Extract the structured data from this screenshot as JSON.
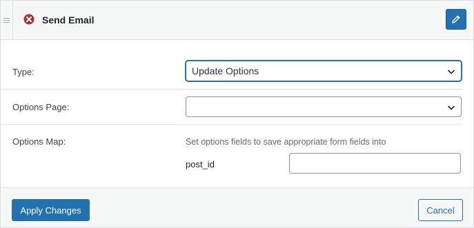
{
  "header": {
    "title": "Send Email",
    "status_icon": "error-circle-icon",
    "status_color": "#b32d2e",
    "edit_icon": "pencil-icon"
  },
  "fields": {
    "type": {
      "label": "Type:",
      "value": "Update Options"
    },
    "options_page": {
      "label": "Options Page:",
      "value": ""
    },
    "options_map": {
      "label": "Options Map:",
      "help": "Set options fields to save appropriate form fields into",
      "items": [
        {
          "key": "post_id",
          "value": ""
        }
      ]
    }
  },
  "footer": {
    "apply_label": "Apply Changes",
    "cancel_label": "Cancel"
  },
  "colors": {
    "accent": "#2271b1",
    "header_bg": "#f6f7f7"
  }
}
